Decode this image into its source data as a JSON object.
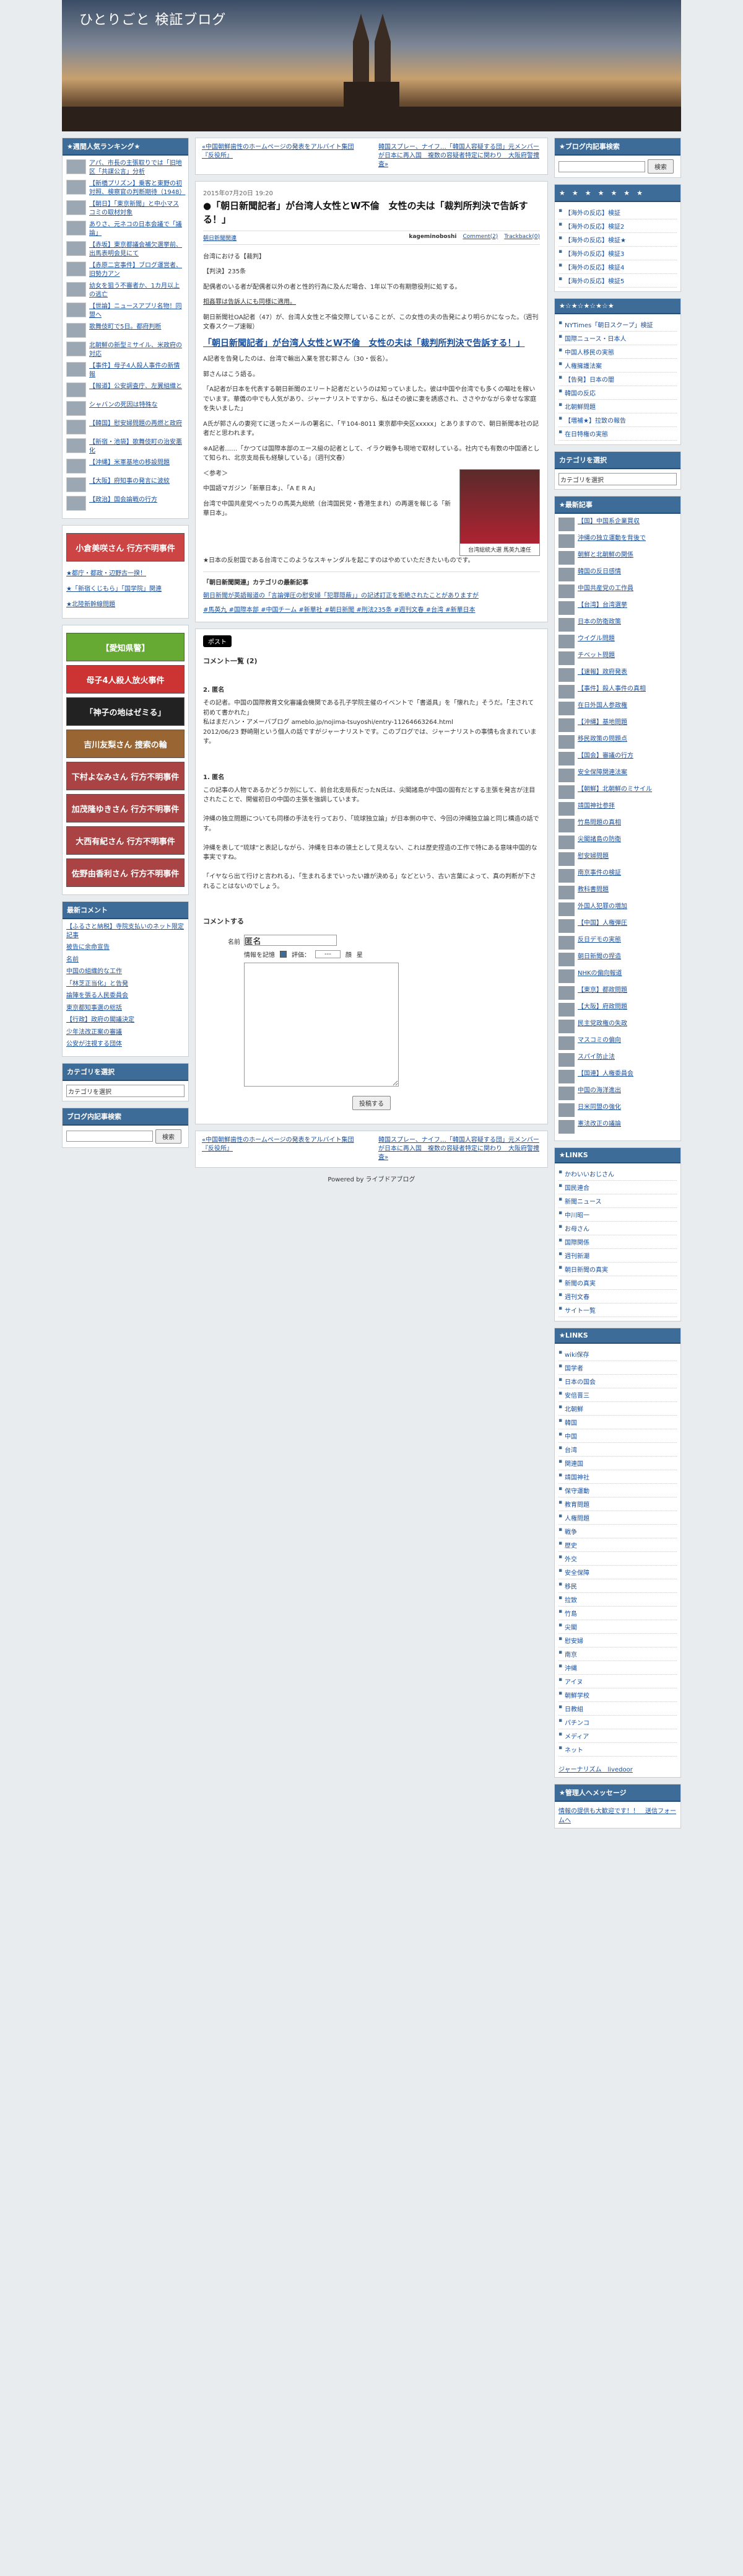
{
  "blog": {
    "title": "ひとりごと 検証ブログ"
  },
  "left": {
    "ranking_title": "★週間人気ランキング★",
    "ranking": [
      "アパ、市長の主張取りでは「旧地区「共謀公言」分析",
      "【新橋プリズン】乗客と東野の初対照、検察官の判断期待（1948）",
      "【朝日】「東京新聞」と中小マスコミの取材対象",
      "ありさ、元ネコの日本会議で「議論」",
      "【赤坂】東京都議会補欠選挙前、出馬表明会見にて",
      "【赤原二宮事件】ブログ運営者、旧勢力アン",
      "幼女を狙う不審者か、1カ月以上の逃亡",
      "【世論】ニュースアプリ名物！同盟へ",
      "歌舞伎町で5日。都府判断",
      "北朝鮮の新型ミサイル、米政府の対応",
      "【事件】母子4人殺人事件の新情報",
      "【報道】公安調査庁、左翼組織と",
      "シャバンの死因は特殊な",
      "【韓国】慰安婦問題の再燃と政府",
      "【新宿・池袋】歌舞伎町の治安悪化",
      "【沖縄】米軍基地の移設問題",
      "【大阪】府知事の発言に波紋",
      "【政治】国会論戦の行方"
    ],
    "banners": [
      "小倉美咲さん 行方不明事件",
      "★都庁・都政・辺野古一揆！",
      "★「新宿くじもら」「国学院」関連",
      "★北陸新幹線問題"
    ],
    "banners2": [
      "【愛知県警】",
      "母子4人殺人放火事件",
      "「神子の地はゼミる」",
      "吉川友梨さん 捜索の輪",
      "下村よなみさん 行方不明事件",
      "加茂隆ゆきさん 行方不明事件",
      "大西有紀さん 行方不明事件",
      "佐野由香利さん 行方不明事件"
    ],
    "recent_title": "最新コメント",
    "recent": [
      "【ふるさと納税】寺院支払いのネット限定記事",
      "被告に余命宣告",
      "名前",
      "中国の組織的な工作",
      "「林芝正当化」と告発",
      "論陣を張る人民委員会",
      "東京都知事選の総括",
      "【行政】政府の閣議決定",
      "少年法改正案の審議",
      "公安が注視する団体"
    ],
    "cat_title": "カテゴリを選択",
    "cat_select": "カテゴリを選択",
    "search_title": "ブログ内記事検索",
    "search_btn": "検索"
  },
  "main": {
    "nav_prev": "«中国朝鮮歯性のホームページの発表をアルバイト集団『反役所』",
    "nav_next": "韓国スプレー、ナイフ…「韓国人容疑する団」元メンバーが日本に再入国　複数の容疑者特定に関わり　大阪府警捜査»",
    "date": "2015年07月20日 19:20",
    "title": "●「朝日新聞記者」が台湾人女性とW不倫　女性の夫は「裁判所判決で告訴する！」",
    "cat": "朝日新聞関連",
    "author": "kageminoboshi",
    "comments": "Comment(2)",
    "trackback": "Trackback(0)",
    "p1": "台湾における【裁判】",
    "p2": "【判決】235条",
    "p3": "配偶者のいる者が配偶者以外の者と性的行為に及んだ場合、1年以下の有期懲役刑に処する。",
    "p4": "相姦罪は告訴人にも同様に適用。",
    "p5": "朝日新聞社OA記者（47）が、台湾人女性と不倫交際していることが、この女性の夫の告発により明らかになった。（週刊文春スクープ速報）",
    "big": "「朝日新聞記者」が台湾人女性とW不倫　女性の夫は「裁判所判決で告訴する！」",
    "p6": "A記者を告発したのは、台湾で輸出入業を営む郭さん（30・仮名）。",
    "p7": "郭さんはこう語る。",
    "p8": "「A記者が日本を代表する朝日新聞のエリート記者だというのは知っていました。彼は中国や台湾でも多くの嘔吐を稼いでいます。華僑の中でも人気があり、ジャーナリストですから、私はその彼に妻を誘惑され、ささやかながら幸せな家庭を失いました」",
    "p9": "A氏が郭さんの妻宛てに送ったメールの署名に、「〒104-8011 東京都中央区xxxxx」とありますので、朝日新聞本社の記者だと思われます。",
    "p10": "※A記者……「かつては国際本部のエース級の記者として、イラク戦争も現地で取材している。社内でも有数の中国通として知られ、北京支局長も経験している」（週刊文春）",
    "p11": "＜参考＞",
    "p12": "中国語マガジン「新華日本」、「A E R A」",
    "p13": "台湾で中国共産党べったりの馬英九総統（台湾国民党・香港生まれ）の再選を報じる「新華日本」。",
    "p14": "★日本の反射国である台湾でこのようなスキャンダルを起こすのはやめていただきたいものです。",
    "photo_caption": "台湾総統大選 馬英九連任",
    "rel_title": "「朝日新聞関連」カテゴリの最新記事",
    "rel_item": "朝日新聞が英語報道の「言論弾圧の慰安婦「犯罪隠蔽」」の記述訂正を拒絶されたことがありますが",
    "tags": "#馬英九 #国際本部 #中国チーム #新華社 #朝日新聞 #刑法235条 #週刊文春 #台湾 #新華日本",
    "share": "ポスト",
    "cmt_title": "コメント一覧 (2)",
    "cmt1_head": "2. 匿名",
    "cmt1": "その記者。中国の国際教育文化審議会機関である孔子学院主催のイベントで「書道具」を「懐れた」そうだ。「主されて初めて書かれた」\n私はまだハン・アメーバブログ ameblo.jp/nojima-tsuyoshi/entry-11264663264.html\n2012/06/23 野崎剛という個人の話ですがジャーナリストです。このブログでは、ジャーナリストの事情も含まれています。",
    "cmt2_head": "1. 匿名",
    "cmt2": "この記事の人物であるかどうか別にして、前台北支局長だったN氏は、尖閣諸島が中国の固有だとする主張を発言が注目されたことで、開催初日の中国の主張を強調しています。\n\n沖縄の独立問題についても同様の手法を行っており、「琉球独立論」が日本側の中で、今回の沖縄独立論と同じ構造の話です。\n\n沖縄を表して”琉球”と表記しながら、沖縄を日本の領土として見えない、これは歴史捏造の工作で特にある意味中国的な事実ですね。\n\n「イヤなら出て行けと言われる」、「生まれるまでいったい誰が決める」などという、古い言葉によって、真の判断が下されることはないのでしょう。",
    "form_title": "コメントする",
    "f_name": "名前",
    "f_name_val": "匿名",
    "f_remember": "情報を記憶",
    "f_eval": "評価：",
    "f_eval_val": "---",
    "f_off": "顔",
    "f_on": "星",
    "f_submit": "投稿する",
    "powered": "Powered by ライブドアブログ"
  },
  "right": {
    "search_title": "★ブログ内記事検索",
    "search_btn": "検索",
    "stars": "★　★　★　★　★　★　★",
    "links1": [
      "【海外の反応】検証",
      "【海外の反応】検証2",
      "【海外の反応】検証★",
      "【海外の反応】検証3",
      "【海外の反応】検証4",
      "【海外の反応】検証5"
    ],
    "stars2": "★☆★☆★☆★☆★",
    "links2": [
      "NYTimes「朝日スクープ」検証",
      "国際ニュース・日本人",
      "中国人移民の実態",
      "人権擁護法案",
      "【告発】日本の闇",
      "韓国の反応",
      "北朝鮮問題",
      "【増補★】拉致の報告",
      "在日特権の実態"
    ],
    "cat_title": "カテゴリを選択",
    "cat_select": "カテゴリを選択",
    "latest_title": "★最新記事",
    "latest": [
      "【国】中国系企業買収",
      "沖縄の独立運動を背後で",
      "朝鮮と北朝鮮の関係",
      "韓国の反日感情",
      "中国共産党の工作員",
      "【台湾】台湾選挙",
      "日本の防衛政策",
      "ウイグル問題",
      "チベット問題",
      "【速報】政府発表",
      "【事件】殺人事件の真相",
      "在日外国人参政権",
      "【沖縄】基地問題",
      "移民政策の問題点",
      "【国会】審議の行方",
      "安全保障関連法案",
      "【朝鮮】北朝鮮のミサイル",
      "靖国神社参拝",
      "竹島問題の真相",
      "尖閣諸島の防衛",
      "慰安婦問題",
      "南京事件の検証",
      "教科書問題",
      "外国人犯罪の増加",
      "【中国】人権弾圧",
      "反日デモの実態",
      "朝日新聞の捏造",
      "NHKの偏向報道",
      "【東京】都政問題",
      "【大阪】府政問題",
      "民主党政権の失政",
      "マスコミの偏向",
      "スパイ防止法",
      "【国連】人権委員会",
      "中国の海洋進出",
      "日米同盟の強化",
      "憲法改正の議論"
    ],
    "links_title": "★LINKS",
    "links3": [
      "かわいいおじさん",
      "国民連合",
      "新聞ニュース",
      "中川昭一",
      "お母さん",
      "国際関係",
      "週刊新潮",
      "朝日新聞の真実",
      "新聞の真実",
      "週刊文春",
      "サイト一覧"
    ],
    "links4_title": "★LINKS",
    "links4": [
      "wiki保存",
      "国学者",
      "日本の国会",
      "安倍晋三",
      "北朝鮮",
      "韓国",
      "中国",
      "台湾",
      "関連国",
      "靖国神社",
      "保守運動",
      "教育問題",
      "人権問題",
      "戦争",
      "歴史",
      "外交",
      "安全保障",
      "移民",
      "拉致",
      "竹島",
      "尖閣",
      "慰安婦",
      "南京",
      "沖縄",
      "アイヌ",
      "朝鮮学校",
      "日教組",
      "パチンコ",
      "メディア",
      "ネット"
    ],
    "jn": "ジャーナリズム　livedoor",
    "admin_title": "★管理人へメッセージ",
    "admin": "情報の提供も大歓迎です！！　送信フォームへ"
  }
}
